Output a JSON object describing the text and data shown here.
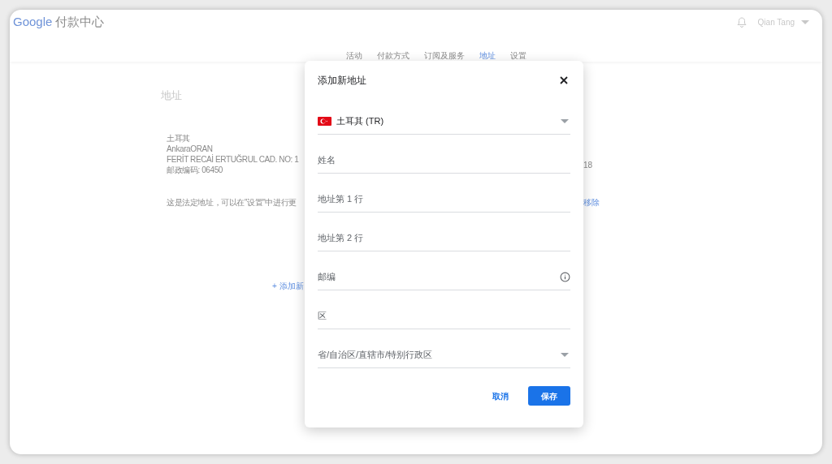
{
  "header": {
    "logo": "Google",
    "product": "付款中心",
    "user": "Qian Tang"
  },
  "nav_tabs": [
    {
      "label": "活动",
      "selected": false
    },
    {
      "label": "付款方式",
      "selected": false
    },
    {
      "label": "订阅及服务",
      "selected": false
    },
    {
      "label": "地址",
      "selected": true
    },
    {
      "label": "设置",
      "selected": false
    }
  ],
  "page": {
    "title": "地址",
    "address_lines": [
      "土耳其",
      "AnkaraORAN",
      "FERİT RECAİ ERTUĞRUL CAD. NO: 1",
      "邮政编码: 06450"
    ],
    "note": "这是法定地址，可以在\"设置\"中进行更",
    "second_address_tail": "18",
    "remove_link": "移除",
    "add_link": "+ 添加新"
  },
  "dialog": {
    "title": "添加新地址",
    "fields": [
      {
        "kind": "country",
        "value": "土耳其 (TR)"
      },
      {
        "kind": "text",
        "placeholder": "姓名"
      },
      {
        "kind": "text",
        "placeholder": "地址第 1 行"
      },
      {
        "kind": "text",
        "placeholder": "地址第 2 行"
      },
      {
        "kind": "text_info",
        "placeholder": "邮编"
      },
      {
        "kind": "text",
        "placeholder": "区"
      },
      {
        "kind": "select",
        "placeholder": "省/自治区/直辖市/特别行政区"
      }
    ],
    "cancel": "取消",
    "save": "保存"
  }
}
